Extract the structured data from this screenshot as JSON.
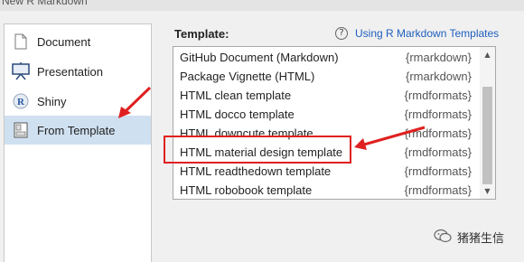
{
  "window": {
    "title": "New R Markdown"
  },
  "sidebar": {
    "items": [
      {
        "label": "Document",
        "icon": "document-icon",
        "selected": false
      },
      {
        "label": "Presentation",
        "icon": "presentation-icon",
        "selected": false
      },
      {
        "label": "Shiny",
        "icon": "shiny-icon",
        "selected": false
      },
      {
        "label": "From Template",
        "icon": "template-icon",
        "selected": true
      }
    ]
  },
  "template_panel": {
    "label": "Template:",
    "help_icon": "help-icon",
    "help_link": "Using R Markdown Templates",
    "templates": [
      {
        "name": "GitHub Document (Markdown)",
        "package": "{rmarkdown}"
      },
      {
        "name": "Package Vignette (HTML)",
        "package": "{rmarkdown}"
      },
      {
        "name": "HTML clean template",
        "package": "{rmdformats}"
      },
      {
        "name": "HTML docco template",
        "package": "{rmdformats}"
      },
      {
        "name": "HTML downcute template",
        "package": "{rmdformats}"
      },
      {
        "name": "HTML material design template",
        "package": "{rmdformats}",
        "highlighted": true
      },
      {
        "name": "HTML readthedown template",
        "package": "{rmdformats}"
      },
      {
        "name": "HTML robobook template",
        "package": "{rmdformats}"
      }
    ]
  },
  "annotations": {
    "arrow_color": "#e02020",
    "highlight_color": "#e02020"
  },
  "watermark": {
    "text": "猪猪生信",
    "icon": "wechat-icon"
  },
  "colors": {
    "selected_bg": "#cfe0f0",
    "link": "#1f5fbf"
  }
}
